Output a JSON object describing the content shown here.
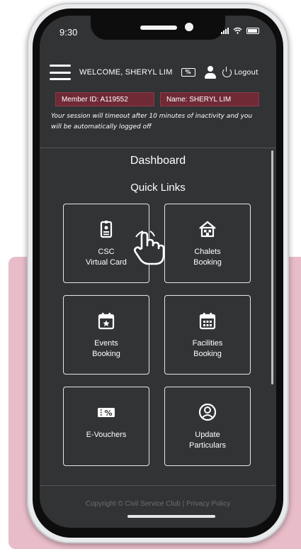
{
  "status_bar": {
    "time": "9:30"
  },
  "header": {
    "welcome": "WELCOME, SHERYL LIM",
    "voucher_glyph": "%",
    "logout": "Logout"
  },
  "member": {
    "id": "Member ID: A119552",
    "name": "Name: SHERYL LIM"
  },
  "timeout_notice": "Your session will timeout after 10 minutes of inactivity and you will be automatically logged off",
  "dashboard": {
    "title": "Dashboard",
    "quick_links_title": "Quick Links",
    "tiles": [
      {
        "line1": "CSC",
        "line2": "Virtual Card",
        "icon": "id-badge-icon"
      },
      {
        "line1": "Chalets",
        "line2": "Booking",
        "icon": "chalet-house-icon"
      },
      {
        "line1": "Events",
        "line2": "Booking",
        "icon": "event-calendar-icon"
      },
      {
        "line1": "Facilities",
        "line2": "Booking",
        "icon": "facilities-calendar-icon"
      },
      {
        "line1": "E-Vouchers",
        "line2": "",
        "icon": "voucher-icon"
      },
      {
        "line1": "Update",
        "line2": "Particulars",
        "icon": "user-circle-icon"
      }
    ]
  },
  "footer": {
    "text": "Copyright © Civil Service Club | Privacy Policy"
  },
  "colors": {
    "screen_bg": "#313335",
    "badge_bg": "#6f2a36",
    "accent_pink": "#e8bcc8"
  }
}
